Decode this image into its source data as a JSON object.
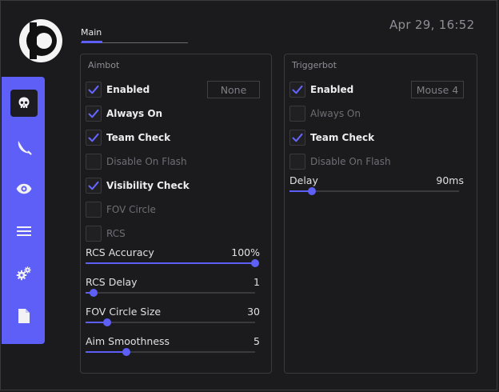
{
  "header": {
    "tab_main": "Main",
    "datetime": "Apr 29, 16:52"
  },
  "sidebar": {
    "items": [
      {
        "icon": "skull-icon",
        "active": true
      },
      {
        "icon": "knife-icon",
        "active": false
      },
      {
        "icon": "eye-icon",
        "active": false
      },
      {
        "icon": "list-icon",
        "active": false
      },
      {
        "icon": "gears-icon",
        "active": false
      },
      {
        "icon": "document-icon",
        "active": false
      }
    ]
  },
  "aimbot": {
    "title": "Aimbot",
    "keybind": "None",
    "checks": [
      {
        "label": "Enabled",
        "checked": true
      },
      {
        "label": "Always On",
        "checked": true
      },
      {
        "label": "Team Check",
        "checked": true
      },
      {
        "label": "Disable On Flash",
        "checked": false
      },
      {
        "label": "Visibility Check",
        "checked": true
      },
      {
        "label": "FOV Circle",
        "checked": false
      },
      {
        "label": "RCS",
        "checked": false
      }
    ],
    "sliders": [
      {
        "label": "RCS Accuracy",
        "value": "100%",
        "fraction": 1.0
      },
      {
        "label": "RCS Delay",
        "value": "1",
        "fraction": 0.045
      },
      {
        "label": "FOV Circle Size",
        "value": "30",
        "fraction": 0.125
      },
      {
        "label": "Aim Smoothness",
        "value": "5",
        "fraction": 0.24
      }
    ]
  },
  "triggerbot": {
    "title": "Triggerbot",
    "keybind": "Mouse 4",
    "checks": [
      {
        "label": "Enabled",
        "checked": true
      },
      {
        "label": "Always On",
        "checked": false
      },
      {
        "label": "Team Check",
        "checked": true
      },
      {
        "label": "Disable On Flash",
        "checked": false
      }
    ],
    "sliders": [
      {
        "label": "Delay",
        "value": "90ms",
        "fraction": 0.13
      }
    ]
  },
  "colors": {
    "accent": "#5d5ff6",
    "background": "#1b1b1d",
    "border": "#3a3a3e"
  }
}
